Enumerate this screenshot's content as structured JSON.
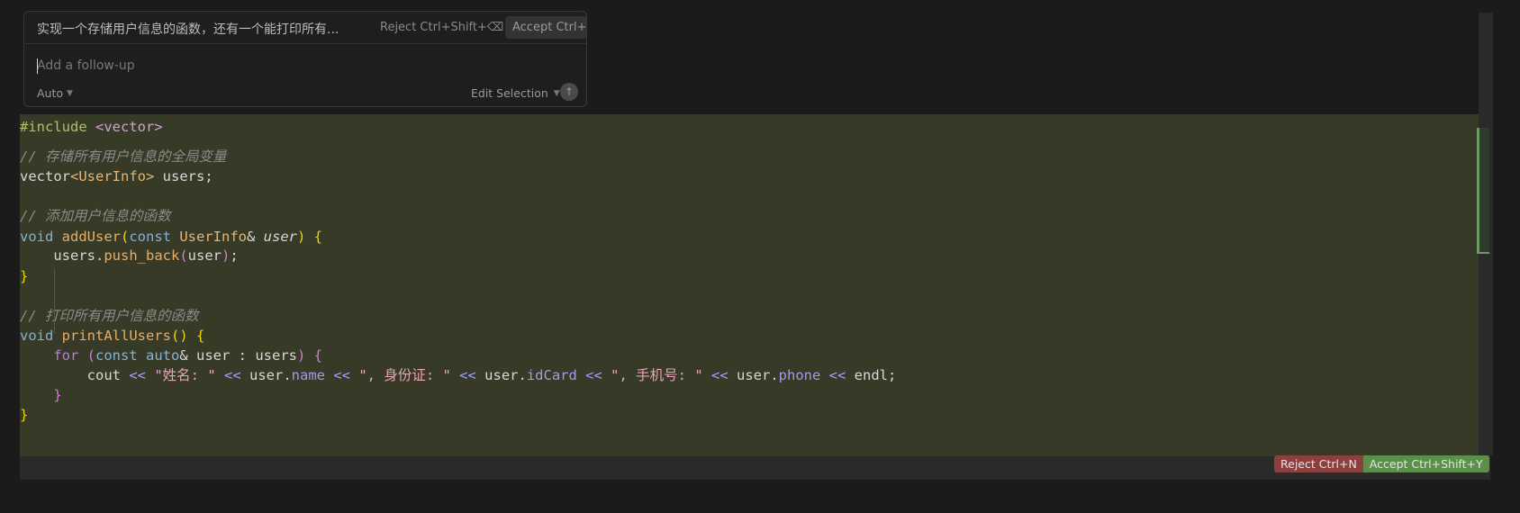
{
  "chat": {
    "prompt": "实现一个存储用户信息的函数，还有一个能打印所有...",
    "reject_label": "Reject Ctrl+Shift+⌫",
    "accept_label": "Accept Ctrl+⏎",
    "followup_placeholder": "Add a follow-up",
    "mode_value": "Auto",
    "edit_scope": "Edit Selection",
    "mode_icon": "chevron-down-icon",
    "send_icon": "arrow-up-icon"
  },
  "code": {
    "line1_a": "#include",
    "line1_b": " <vector>",
    "line3": "// 存储所有用户信息的全局变量",
    "line4_a": "vector",
    "line4_b": "<UserInfo>",
    "line4_c": " users;",
    "line6": "// 添加用户信息的函数",
    "line7_void": "void",
    "line7_fn": " addUser",
    "line7_open": "(",
    "line7_const": "const",
    "line7_type": " UserInfo",
    "line7_amp": "& ",
    "line7_param": "user",
    "line7_close": ")",
    "line7_brace": " {",
    "line8_a": "    users.",
    "line8_fn": "push_back",
    "line8_open": "(",
    "line8_arg": "user",
    "line8_close": ")",
    "line8_end": ";",
    "line9": "}",
    "line11": "// 打印所有用户信息的函数",
    "line12_void": "void",
    "line12_fn": " printAllUsers",
    "line12_paren": "()",
    "line12_brace": " {",
    "line13_indent": "    ",
    "line13_for": "for",
    "line13_open": " (",
    "line13_const": "const",
    "line13_auto": " auto",
    "line13_rest": "& user : users",
    "line13_close": ")",
    "line13_brace": " {",
    "line14_a": "        cout ",
    "line14_op1": "<<",
    "line14_s1": " \"姓名: \" ",
    "line14_op2": "<<",
    "line14_u1": " user.",
    "line14_m1": "name",
    "line14_op3": " <<",
    "line14_s2": " \", 身份证: \" ",
    "line14_op4": "<<",
    "line14_u2": " user.",
    "line14_m2": "idCard",
    "line14_op5": " <<",
    "line14_s3": " \", 手机号: \" ",
    "line14_op6": "<<",
    "line14_u3": " user.",
    "line14_m3": "phone",
    "line14_op7": " <<",
    "line14_end": " endl;",
    "line15": "    }",
    "line16": "}"
  },
  "diff": {
    "reject_label": "Reject Ctrl+N",
    "accept_label": "Accept Ctrl+Shift+Y"
  },
  "colors": {
    "highlight_bg": "#363a26",
    "reject_bg": "#8b3f3f",
    "accept_bg": "#5b8f4a"
  }
}
